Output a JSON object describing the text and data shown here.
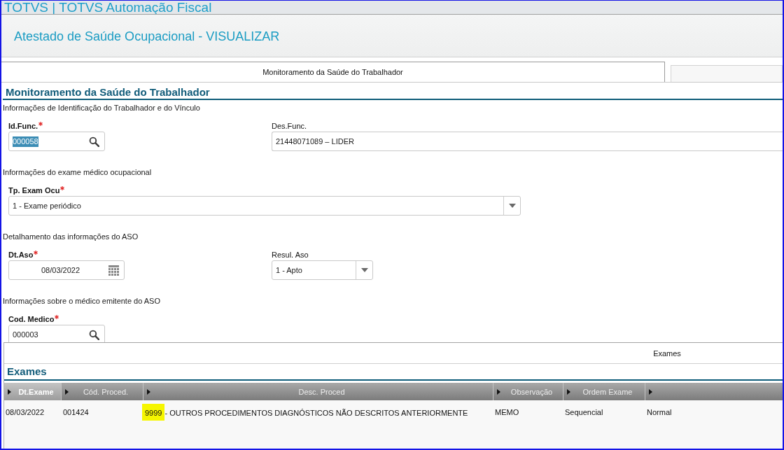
{
  "app_bar": {
    "title": "TOTVS | TOTVS Automação Fiscal"
  },
  "page_header": {
    "title": "Atestado de Saúde Ocupacional - VISUALIZAR"
  },
  "tabs": [
    {
      "label": "Monitoramento da Saúde do Trabalhador",
      "selected": true
    },
    {
      "selected": false
    }
  ],
  "section": {
    "title": "Monitoramento da Saúde do Trabalhador",
    "groups": [
      {
        "title": "Informações de Identificação do Trabalhador e do Vínculo",
        "fields": [
          {
            "kind": "lookup",
            "label": "Id.Func.",
            "required": true,
            "value": "000058",
            "value_selected": true
          },
          {
            "kind": "text",
            "label": "Des.Func.",
            "required": false,
            "value": "21448071089 – LIDER",
            "value_selected": false
          }
        ]
      },
      {
        "title": "Informações do exame médico ocupacional",
        "fields": [
          {
            "kind": "select",
            "label": "Tp. Exam Ocu",
            "required": true,
            "value": "1 - Exame periódico",
            "value_selected": false
          }
        ]
      },
      {
        "title": "Detalhamento das informações do ASO",
        "fields": [
          {
            "kind": "date",
            "label": "Dt.Aso",
            "required": true,
            "value": "08/03/2022",
            "value_selected": false
          },
          {
            "kind": "select",
            "label": "Resul. Aso",
            "required": false,
            "value": "1 - Apto",
            "value_selected": false
          }
        ]
      },
      {
        "title": "Informações sobre o médico emitente do ASO",
        "fields": [
          {
            "kind": "lookup",
            "label": "Cod. Medico",
            "required": true,
            "value": "000003",
            "value_selected": false
          }
        ]
      }
    ]
  },
  "detail_tabs": [
    {
      "label": "Exames",
      "selected": true
    }
  ],
  "exames": {
    "title": "Exames",
    "columns": [
      {
        "label": "Dt.Exame",
        "selected": true
      },
      {
        "label": "Cód. Proced.",
        "selected": false
      },
      {
        "label": "Desc. Proced",
        "selected": false
      },
      {
        "label": "Observação",
        "selected": false
      },
      {
        "label": "Ordem Exame",
        "selected": false
      },
      {
        "selected": false
      }
    ],
    "rows": [
      {
        "cells": [
          "08/03/2022",
          "001424",
          {
            "parts": [
              {
                "text": "9999 ",
                "highlighted": true
              },
              {
                "text": "- OUTROS PROCEDIMENTOS DIAGNÓSTICOS NÃO DESCRITOS ANTERIORMENTE",
                "highlighted": false
              }
            ]
          },
          "MEMO",
          "Sequencial",
          "Normal"
        ]
      }
    ]
  }
}
